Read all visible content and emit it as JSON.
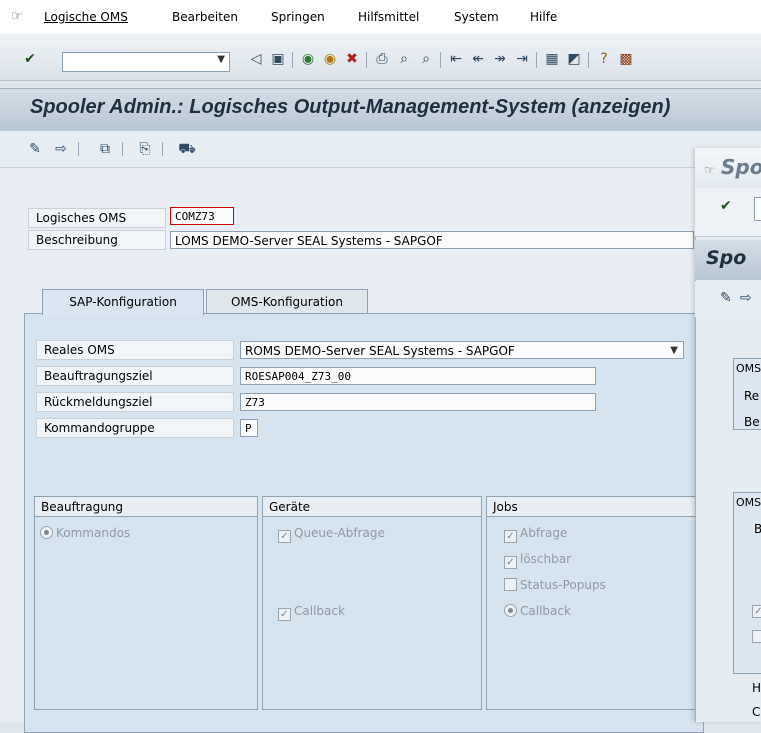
{
  "menubar": {
    "items": [
      "Logische OMS",
      "Bearbeiten",
      "Springen",
      "Hilfsmittel",
      "System",
      "Hilfe"
    ]
  },
  "toolbar": {
    "command_field_value": ""
  },
  "title": "Spooler Admin.: Logisches Output-Management-System (anzeigen)",
  "header_fields": {
    "logisches_oms_label": "Logisches OMS",
    "logisches_oms_value": "COMZ73",
    "beschreibung_label": "Beschreibung",
    "beschreibung_value": "LOMS DEMO-Server SEAL Systems - SAPGOF"
  },
  "tabs": [
    {
      "label": "SAP-Konfiguration",
      "active": true
    },
    {
      "label": "OMS-Konfiguration",
      "active": false
    }
  ],
  "sap_config": {
    "reales_oms_label": "Reales OMS",
    "reales_oms_value": "ROMS DEMO-Server SEAL Systems - SAPGOF",
    "beauftragungsziel_label": "Beauftragungsziel",
    "beauftragungsziel_value": "ROESAP004_Z73_00",
    "rueckmeldungsziel_label": "Rückmeldungsziel",
    "rueckmeldungsziel_value": "Z73",
    "kommandogruppe_label": "Kommandogruppe",
    "kommandogruppe_value": "P"
  },
  "groups": {
    "beauftragung": {
      "title": "Beauftragung",
      "options": [
        "Kommandos"
      ]
    },
    "geraete": {
      "title": "Geräte",
      "options": [
        "Queue-Abfrage",
        "Callback"
      ]
    },
    "jobs": {
      "title": "Jobs",
      "options": [
        "Abfrage",
        "löschbar",
        "Status-Popups",
        "Callback"
      ]
    }
  },
  "second_window": {
    "title_fragment": "Spo",
    "header_fragment": "Spo",
    "labels": [
      "OMS",
      "Re",
      "Be",
      "OMS",
      "B",
      "H",
      "C"
    ]
  },
  "colors": {
    "title_text": "#1e2f40",
    "panel_bg": "#d6e4f0",
    "frame_bg": "#e8eef3"
  }
}
